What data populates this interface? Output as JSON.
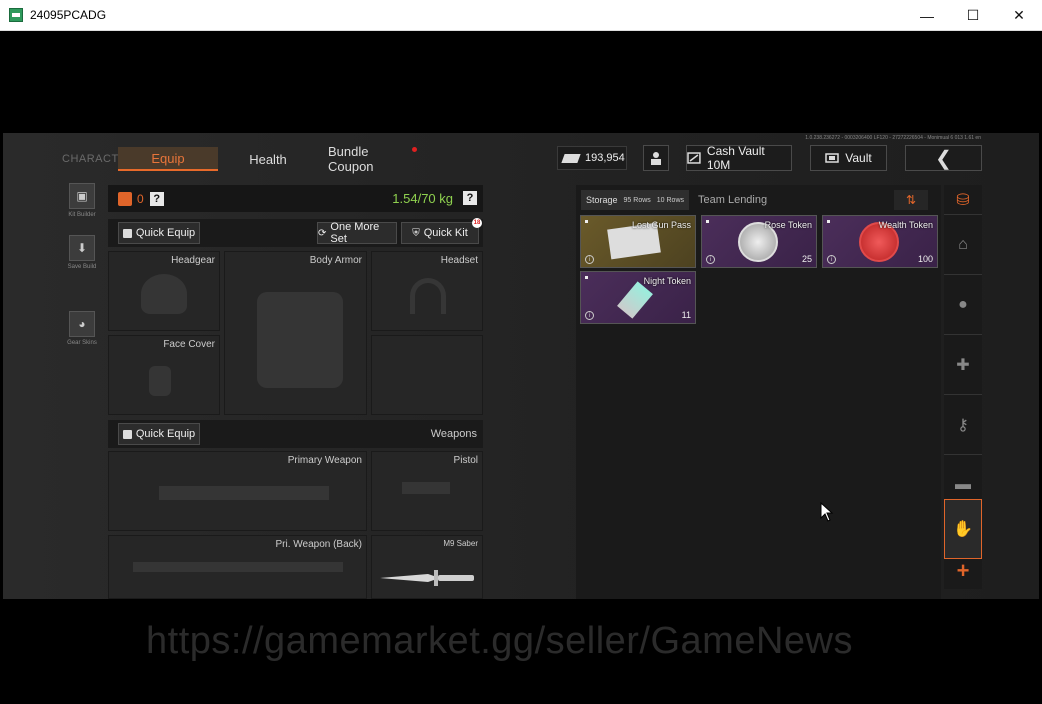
{
  "window": {
    "title": "24095PCADG",
    "minimize": "—",
    "maximize": "☐",
    "close": "✕"
  },
  "game": {
    "version": "1.0.238.236272 - 0003206400 LF120 - 27272226504 - Monimual 6 013 1.61 en",
    "nav": {
      "character": "CHARACTER",
      "equip": "Equip",
      "health": "Health",
      "bundle_coupon": "Bundle Coupon"
    },
    "currency": "193,954",
    "buttons": {
      "cash_vault": "Cash Vault 10M",
      "vault": "Vault",
      "back": "❮"
    },
    "left_sidebar": [
      {
        "label": "Kit Builder",
        "icon": "vest-icon"
      },
      {
        "label": "Save Build",
        "icon": "download-icon"
      },
      {
        "label": "Gear Skins",
        "icon": "helmet-icon"
      }
    ],
    "equip": {
      "bag_count": "0",
      "help": "?",
      "weight": "1.54/70 kg",
      "quick_equip": "Quick Equip",
      "one_more_set": "One More Set",
      "quick_kit": "Quick Kit",
      "quick_kit_badge": "18",
      "slots": {
        "headgear": "Headgear",
        "body_armor": "Body Armor",
        "headset": "Headset",
        "face_cover": "Face Cover",
        "primary_weapon": "Primary Weapon",
        "pistol": "Pistol",
        "pri_weapon_back": "Pri. Weapon (Back)",
        "m9_saber": "M9 Saber"
      },
      "weapons_quick_equip": "Quick Equip",
      "weapons_label": "Weapons"
    },
    "storage": {
      "tab": "Storage",
      "rows1": "95 Rows",
      "rows2": "10 Rows",
      "team_lending": "Team Lending",
      "items": [
        {
          "name": "Lost Gun Pass",
          "qty": ""
        },
        {
          "name": "Rose Token",
          "qty": "25"
        },
        {
          "name": "Wealth Token",
          "qty": "100"
        },
        {
          "name": "Night Token",
          "qty": "11"
        }
      ]
    },
    "right_sidebar_plus": "+"
  },
  "watermark": "https://gamemarket.gg/seller/GameNews"
}
